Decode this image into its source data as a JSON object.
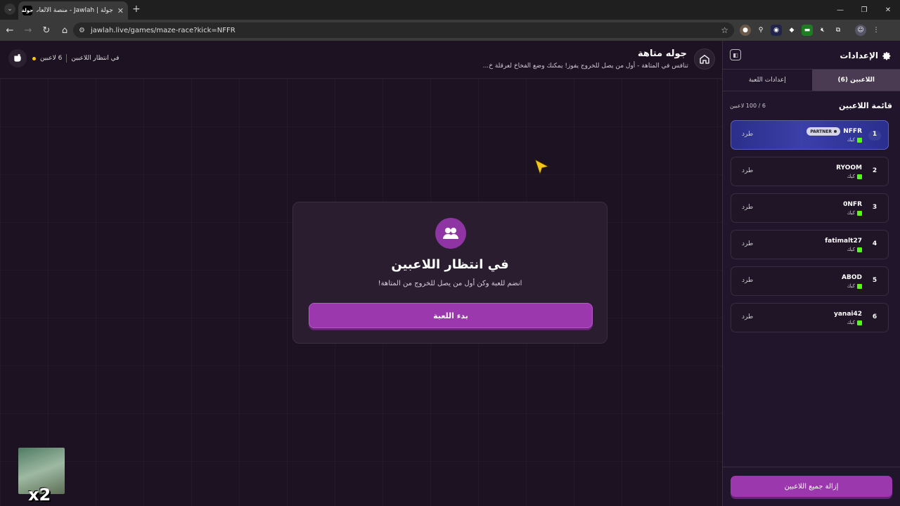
{
  "browser": {
    "tab_title": "جولة | Jawlah - منصة الألعاب الت...",
    "favicon_text": "جولة",
    "url": "jawlah.live/games/maze-race?kick=NFFR"
  },
  "header": {
    "title": "جوله متاهة",
    "description": "تنافس في المتاهة - أول من يصل للخروج يفوز! يمكنك وضع الفخاخ لعرقلة خ...",
    "status_waiting": "في انتظار اللاعبين",
    "status_players": "6 لاعبين"
  },
  "card": {
    "title": "في انتظار اللاعبين",
    "subtitle": "انضم للعبة وكن أول من يصل للخروج من المتاهة!",
    "start_label": "بدء اللعبة"
  },
  "sidebar": {
    "title": "الإعدادات",
    "tabs": [
      {
        "label": "اللاعبين (6)",
        "active": true
      },
      {
        "label": "إعدادات اللعبة",
        "active": false
      }
    ],
    "list_title": "قائمة اللاعبين",
    "list_count": "6 / 100 لاعبين",
    "kick_label": "طرد",
    "platform_label": "كيك",
    "partner_label": "PARTNER",
    "players": [
      {
        "rank": "1",
        "name": "NFFR"
      },
      {
        "rank": "2",
        "name": "RYOOM"
      },
      {
        "rank": "3",
        "name": "0NFR"
      },
      {
        "rank": "4",
        "name": "fatimalt27"
      },
      {
        "rank": "5",
        "name": "ABOD"
      },
      {
        "rank": "6",
        "name": "yanai42"
      }
    ],
    "remove_all_label": "إزالة جميع اللاعبين"
  },
  "overlay": {
    "multiplier": "x2"
  },
  "colors": {
    "accent": "#9b38ae",
    "background": "#1d1221",
    "kick_green": "#53fc18"
  }
}
